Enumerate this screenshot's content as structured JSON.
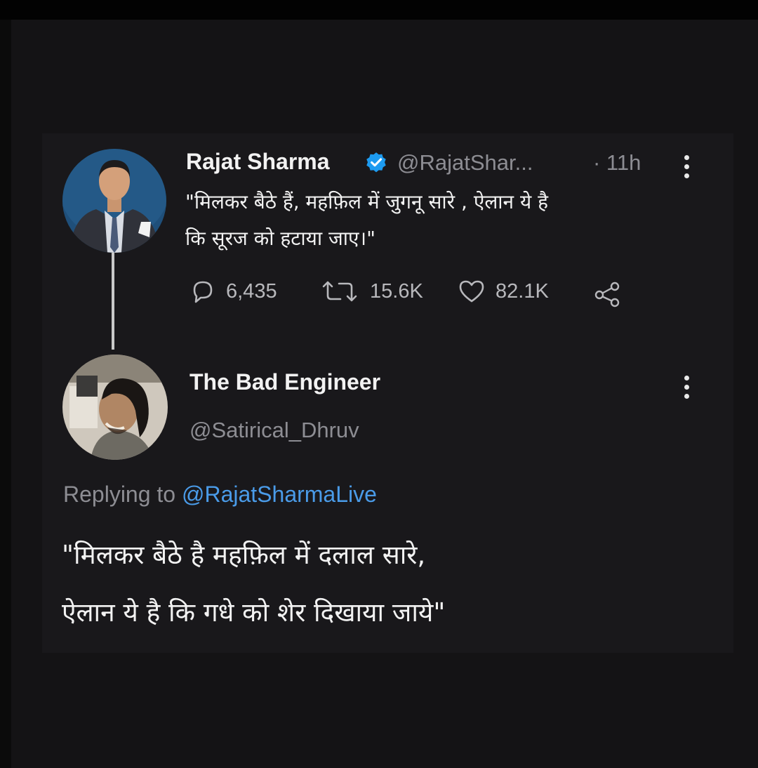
{
  "original_tweet": {
    "author_name": "Rajat Sharma",
    "handle": "@RajatShar...",
    "time": "· 11h",
    "text_line1": "\"मिलकर बैठे हैं, महफ़िल में जुगनू सारे , ऐलान ये है",
    "text_line2": "कि सूरज को हटाया जाए।\"",
    "replies_count": "6,435",
    "retweets_count": "15.6K",
    "likes_count": "82.1K"
  },
  "reply_tweet": {
    "author_name": "The Bad Engineer",
    "handle": "@Satirical_Dhruv",
    "replying_to_label": "Replying to",
    "replying_to_handle": "@RajatSharmaLive",
    "text_line1": "\"मिलकर बैठे है महफ़िल में दलाल सारे,",
    "text_line2": "ऐलान ये है कि गधे को शेर दिखाया जाये\""
  },
  "colors": {
    "background": "#141315",
    "card": "#19181b",
    "text": "#f2f2f2",
    "muted": "#8d8d93",
    "link": "#4a9be8",
    "verified": "#1d9bf0"
  },
  "icons": [
    "verified-badge-icon",
    "more-options-icon",
    "reply-icon",
    "retweet-icon",
    "like-icon",
    "share-icon"
  ]
}
